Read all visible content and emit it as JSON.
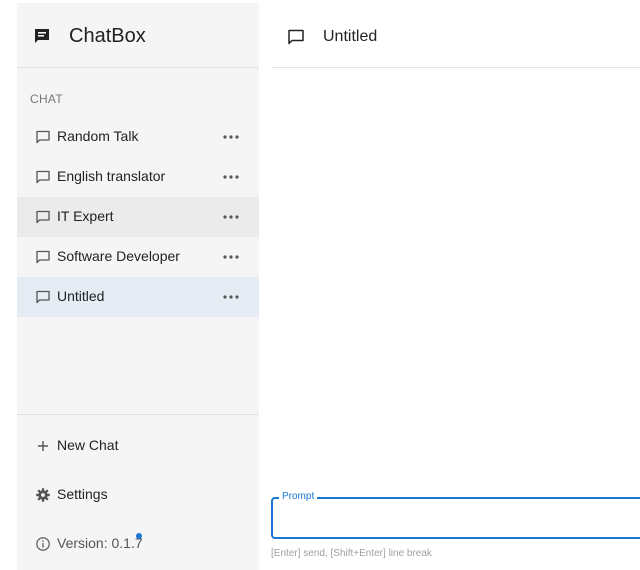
{
  "app": {
    "title": "ChatBox",
    "brand_icon": "chat-bubble-filled-icon"
  },
  "sidebar": {
    "section_label": "CHAT",
    "chats": [
      {
        "label": "Random Talk",
        "icon": "chat-bubble-outline-icon",
        "state": "normal"
      },
      {
        "label": "English translator",
        "icon": "chat-bubble-outline-icon",
        "state": "normal"
      },
      {
        "label": "IT Expert",
        "icon": "chat-bubble-outline-icon",
        "state": "hover"
      },
      {
        "label": "Software Developer",
        "icon": "chat-bubble-outline-icon",
        "state": "normal"
      },
      {
        "label": "Untitled",
        "icon": "chat-bubble-outline-icon",
        "state": "selected"
      }
    ],
    "new_chat_label": "New Chat",
    "settings_label": "Settings",
    "version_label": "Version: 0.1.7",
    "version_badge_color": "#1976d2"
  },
  "main": {
    "title": "Untitled",
    "prompt_label": "Prompt",
    "prompt_value": "",
    "hint": "[Enter] send, [Shift+Enter] line break"
  },
  "colors": {
    "accent": "#1976d2",
    "sidebar_bg": "#f5f5f5",
    "selected_bg": "#e5ecf4",
    "hover_bg": "#ebebeb"
  }
}
